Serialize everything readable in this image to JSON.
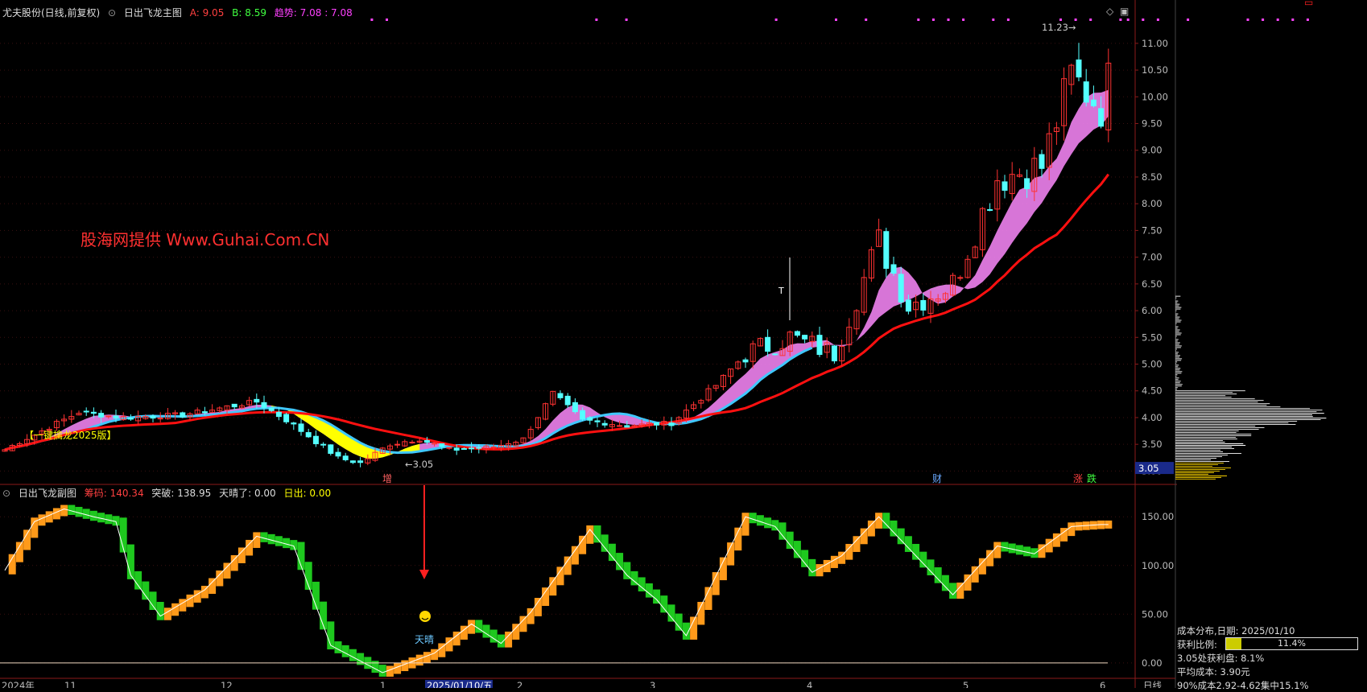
{
  "main_header": {
    "stock": "尤夫股份(日线,前复权)",
    "indicator": "日出飞龙主图",
    "a_label": "A: 9.05",
    "b_label": "B: 8.59",
    "trend_label": "趋势: 7.08 : 7.08"
  },
  "sub_header": {
    "indicator": "日出飞龙副图",
    "chip_label": "筹码: 140.34",
    "breakout_label": "突破: 138.95",
    "sunny_label": "天晴了: 0.00",
    "sunrise_label": "日出: 0.00"
  },
  "watermark": "股海网提供 Www.Guhai.Com.CN",
  "annotations": {
    "banner": "【一键擒龙2025版】",
    "low_marker": "3.05",
    "high_marker": "11.23",
    "t_marker": "T",
    "sunny_text": "天晴",
    "tag_zeng": "增",
    "tag_cai": "财",
    "tag_zhang": "涨",
    "tag_die": "跌",
    "price_tag": "3.05"
  },
  "x_axis": {
    "labels": [
      "2024年",
      "11",
      "12",
      "1",
      "2025/01/10/五",
      "2",
      "3",
      "4",
      "5",
      "6"
    ],
    "mode_label": "日线"
  },
  "cost_panel": {
    "title": "成本分布,日期: 2025/01/10",
    "profit_label": "获利比例:",
    "profit_value": "11.4%",
    "profit_ratio": 0.114,
    "profit_at_price": "3.05处获利盘: 8.1%",
    "avg_cost": "平均成本: 3.90元",
    "cost_90": "90%成本2.92-4.62集中15.1%"
  },
  "colors": {
    "up": "#ff3232",
    "down": "#54ffff",
    "band": "#ee82ee",
    "band_alt": "#ffff00",
    "mid_line": "#40c8ff",
    "long_ma": "#ff1010",
    "orange": "#ff9a1a",
    "green": "#1ec81e"
  },
  "chart_data": [
    {
      "type": "candlestick",
      "title": "日出飞龙主图",
      "ylim": [
        2.75,
        11.6
      ],
      "y_ticks": [
        "11.00",
        "10.50",
        "10.00",
        "9.50",
        "9.00",
        "8.50",
        "8.00",
        "7.50",
        "7.00",
        "6.50",
        "6.00",
        "5.50",
        "5.00",
        "4.50",
        "4.00",
        "3.50",
        "3.00"
      ],
      "n_bars": 150,
      "ohlc": [],
      "anchors": [
        [
          0,
          3.4
        ],
        [
          5,
          3.75
        ],
        [
          10,
          4.1
        ],
        [
          16,
          4.0
        ],
        [
          24,
          4.05
        ],
        [
          30,
          4.2
        ],
        [
          34,
          4.3
        ],
        [
          38,
          3.95
        ],
        [
          42,
          3.55
        ],
        [
          45,
          3.25
        ],
        [
          48,
          3.15
        ],
        [
          52,
          3.5
        ],
        [
          56,
          3.6
        ],
        [
          60,
          3.4
        ],
        [
          66,
          3.45
        ],
        [
          70,
          3.6
        ],
        [
          74,
          4.45
        ],
        [
          78,
          3.95
        ],
        [
          84,
          3.85
        ],
        [
          90,
          3.9
        ],
        [
          96,
          4.6
        ],
        [
          100,
          5.2
        ],
        [
          106,
          5.5
        ],
        [
          112,
          5.2
        ],
        [
          118,
          7.3
        ],
        [
          122,
          6.1
        ],
        [
          128,
          6.5
        ],
        [
          134,
          8.5
        ],
        [
          140,
          8.7
        ],
        [
          144,
          10.4
        ],
        [
          148,
          9.8
        ],
        [
          149,
          10.3
        ]
      ]
    },
    {
      "type": "line",
      "title": "日出飞龙副图",
      "ylim": [
        -15,
        170
      ],
      "y_ticks": [
        "150.00",
        "100.00",
        "50.00",
        "0.00"
      ],
      "series": [
        {
          "name": "筹码",
          "points": [
            [
              0,
              95
            ],
            [
              4,
              145
            ],
            [
              8,
              158
            ],
            [
              12,
              150
            ],
            [
              15,
              145
            ],
            [
              17,
              90
            ],
            [
              21,
              48
            ],
            [
              27,
              75
            ],
            [
              34,
              130
            ],
            [
              39,
              120
            ],
            [
              44,
              18
            ],
            [
              51,
              -10
            ],
            [
              58,
              10
            ],
            [
              63,
              40
            ],
            [
              67,
              20
            ],
            [
              71,
              52
            ],
            [
              79,
              137
            ],
            [
              84,
              90
            ],
            [
              88,
              65
            ],
            [
              92,
              28
            ],
            [
              100,
              150
            ],
            [
              104,
              140
            ],
            [
              109,
              93
            ],
            [
              113,
              110
            ],
            [
              118,
              150
            ],
            [
              123,
              110
            ],
            [
              128,
              70
            ],
            [
              134,
              120
            ],
            [
              139,
              112
            ],
            [
              144,
              140
            ],
            [
              148,
              142
            ]
          ]
        }
      ]
    }
  ]
}
